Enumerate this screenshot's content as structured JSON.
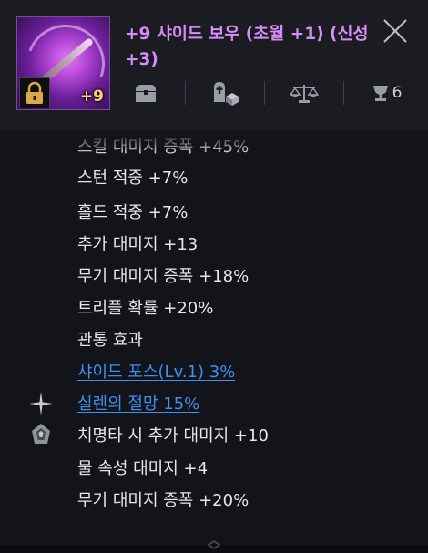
{
  "header": {
    "title": "+9 샤이드 보우 (초월 +1) (신성 +3)",
    "enhance_badge": "+9",
    "icons": [
      {
        "name": "chest-icon"
      },
      {
        "name": "grave-engrave-icon"
      },
      {
        "name": "scale-icon"
      },
      {
        "name": "trophy-icon",
        "count": "6"
      }
    ]
  },
  "stats": [
    {
      "text": "스킬 대미지 증폭 +45%",
      "type": "cut"
    },
    {
      "text": "스턴 적중 +7%",
      "type": "normal"
    },
    {
      "text": "홀드 적중 +7%",
      "type": "normal"
    },
    {
      "text": "추가 대미지 +13",
      "type": "normal"
    },
    {
      "text": "무기 대미지 증폭 +18%",
      "type": "normal"
    },
    {
      "text": "트리플 확률 +20%",
      "type": "normal"
    },
    {
      "text": "관통 효과",
      "type": "normal"
    },
    {
      "text": "샤이드 포스(Lv.1) 3%",
      "type": "link"
    },
    {
      "text": "실렌의 절망 15%",
      "type": "link",
      "icon": "sparkle-icon"
    },
    {
      "text": "치명타 시 추가 대미지 +10",
      "type": "normal",
      "icon": "crystal-icon"
    },
    {
      "text": "물 속성 대미지 +4",
      "type": "normal"
    },
    {
      "text": "무기 대미지 증폭 +20%",
      "type": "normal"
    }
  ],
  "colors": {
    "title": "#d78cf7",
    "link": "#3e8ff0",
    "enhance": "#ffd06a"
  }
}
